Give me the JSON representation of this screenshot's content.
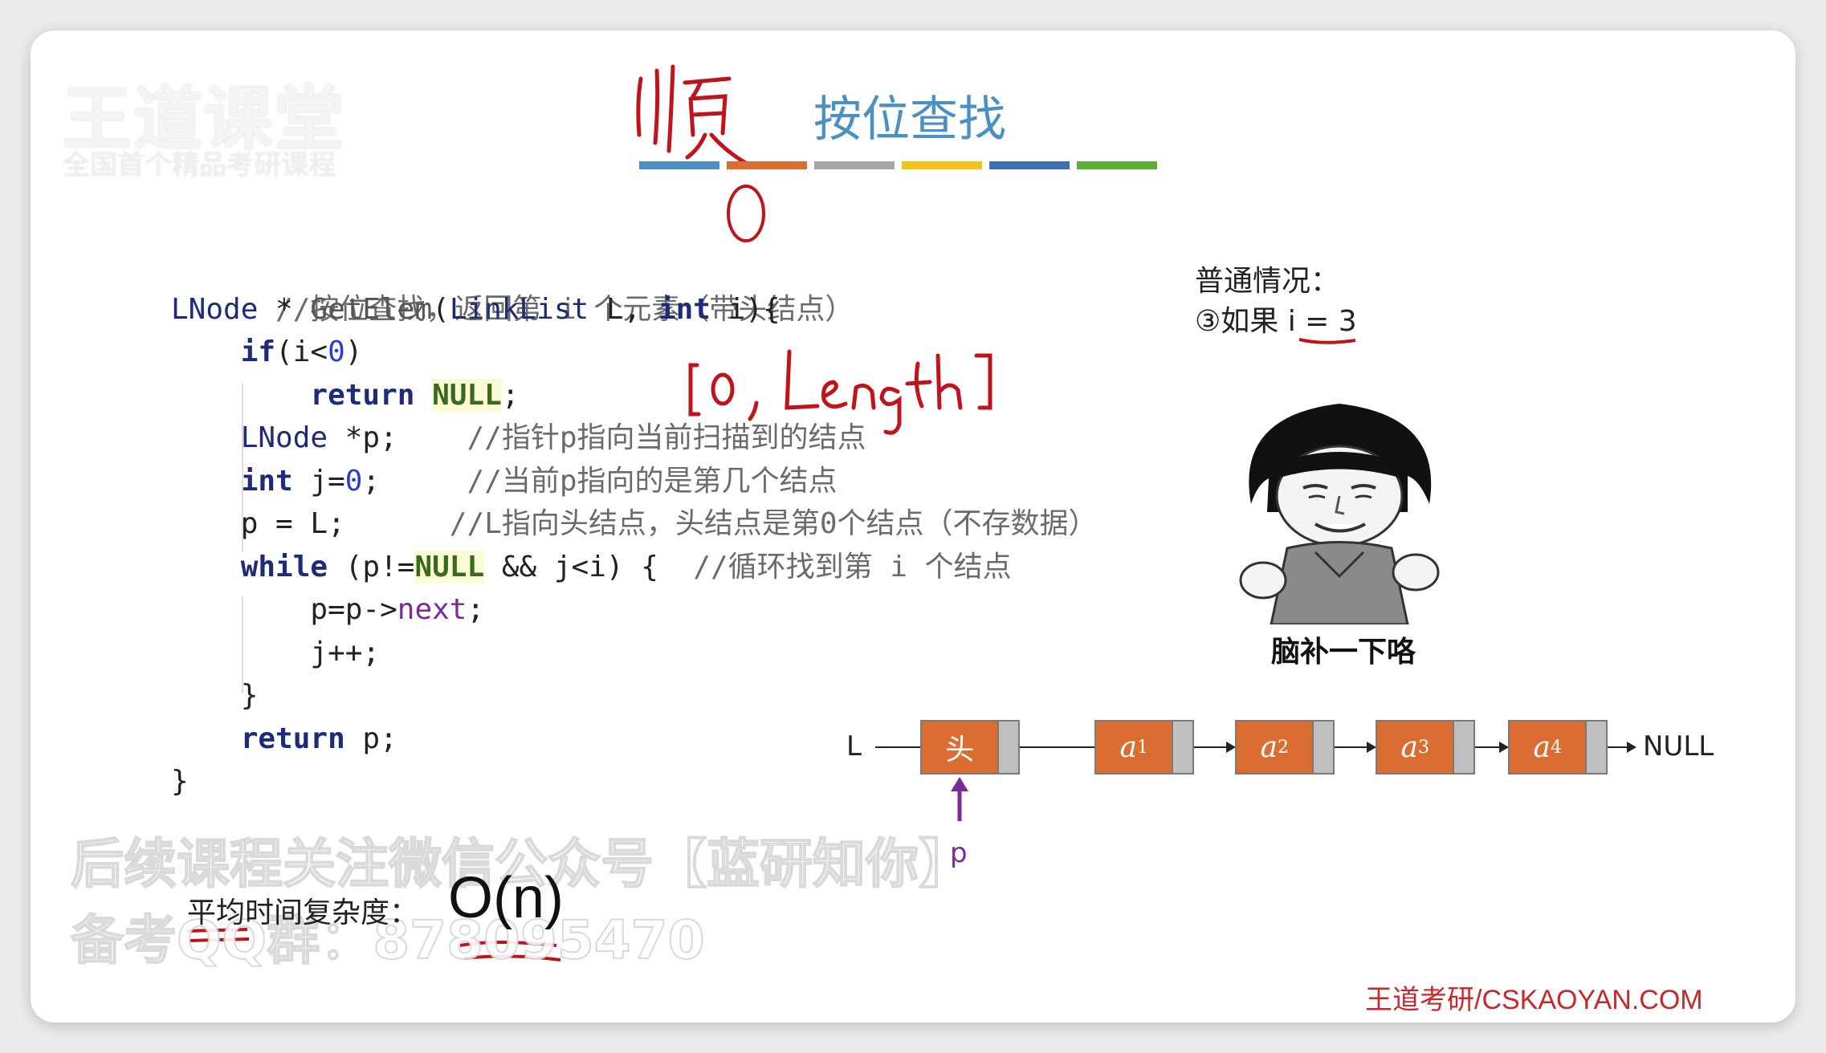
{
  "logo": {
    "main": "王道课堂",
    "sub": "全国首个精品考研课程"
  },
  "handwritten_title": "顺",
  "title": "按位查找",
  "color_bars": [
    "#4a90c2",
    "#db6d33",
    "#a6a6a6",
    "#f0c419",
    "#3d6fb5",
    "#5ab035"
  ],
  "code": {
    "comment_header": "//按位查找，返回第 i 个元素（带头结点）",
    "sig_type": "LNode",
    "sig_star": " * ",
    "sig_fn": "GetElem",
    "sig_open": "(",
    "sig_param_type": "LinkList",
    "sig_param_l": " L, ",
    "sig_int": "int",
    "sig_i": " i",
    "sig_close": "){",
    "if_kw": "if",
    "if_cond_a": "(i<",
    "if_zero": "0",
    "if_cond_b": ")",
    "return_kw": "return",
    "null_val": "NULL",
    "semicolon": ";",
    "decl_p_type": "LNode",
    "decl_p_rest": " *p;",
    "decl_p_comment": "//指针p指向当前扫描到的结点",
    "decl_j_type": "int",
    "decl_j_a": " j=",
    "decl_j_zero": "0",
    "decl_j_b": ";",
    "decl_j_comment": "//当前p指向的是第几个结点",
    "assign_p": "p = L;",
    "assign_p_comment": "//L指向头结点，头结点是第0个结点（不存数据）",
    "while_kw": "while",
    "while_a": " (p!=",
    "while_null": "NULL",
    "while_b": " && j<i) {",
    "while_comment": "//循环找到第 i 个结点",
    "body1_a": "p=p->",
    "body1_next": "next",
    "body1_b": ";",
    "body2": "j++;",
    "close_inner": "}",
    "return_p_kw": "return",
    "return_p_rest": " p;",
    "close_outer": "}"
  },
  "annotation_range": "[0, Length]",
  "note": {
    "line1": "普通情况：",
    "line2_prefix": "③如果 ",
    "line2_cond": "i = 3"
  },
  "meme_caption": "脑补一下咯",
  "linked_list": {
    "head_pointer": "L",
    "head_node": "头",
    "nodes": [
      {
        "base": "a",
        "sub": "1"
      },
      {
        "base": "a",
        "sub": "2"
      },
      {
        "base": "a",
        "sub": "3"
      },
      {
        "base": "a",
        "sub": "4"
      }
    ],
    "tail": "NULL",
    "pointer_label": "p"
  },
  "watermark": {
    "line1": "后续课程关注微信公众号【蓝研知你】",
    "line2": "备考QQ群：878095470"
  },
  "complexity": {
    "label": "平均时间复杂度：",
    "value": "O(n)"
  },
  "footer": "王道考研/CSKAOYAN.COM"
}
